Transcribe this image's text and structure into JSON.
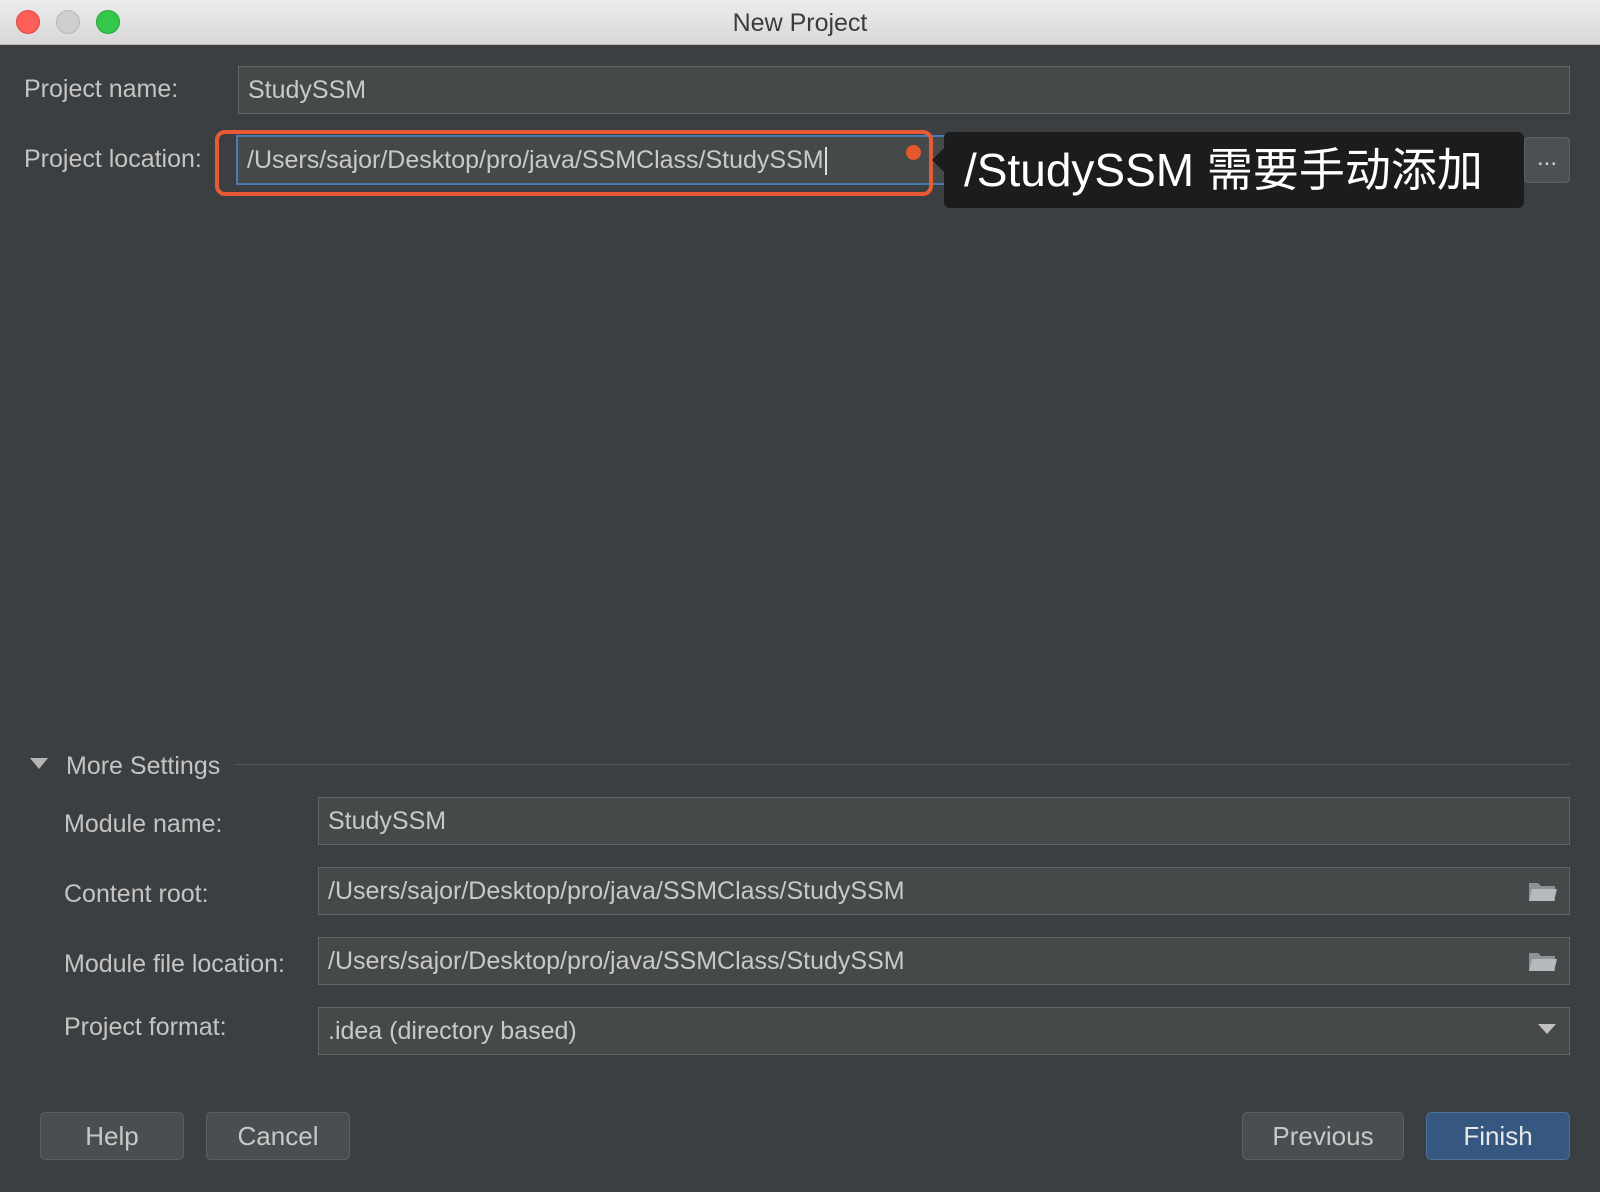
{
  "window": {
    "title": "New Project"
  },
  "project": {
    "name_label": "Project name:",
    "name_value": "StudySSM",
    "location_label": "Project location:",
    "location_value": "/Users/sajor/Desktop/pro/java/SSMClass/StudySSM",
    "browse_label": "..."
  },
  "annotation": {
    "text": "/StudySSM 需要手动添加",
    "color": "#e85a35"
  },
  "more_settings": {
    "title": "More Settings",
    "module_name_label": "Module name:",
    "module_name_value": "StudySSM",
    "content_root_label": "Content root:",
    "content_root_value": "/Users/sajor/Desktop/pro/java/SSMClass/StudySSM",
    "module_file_label": "Module file location:",
    "module_file_value": "/Users/sajor/Desktop/pro/java/SSMClass/StudySSM",
    "format_label": "Project format:",
    "format_value": ".idea (directory based)"
  },
  "buttons": {
    "help": "Help",
    "cancel": "Cancel",
    "previous": "Previous",
    "finish": "Finish"
  },
  "colors": {
    "background": "#3c3f41",
    "accent": "#365880",
    "focus": "#4a7ab3"
  }
}
